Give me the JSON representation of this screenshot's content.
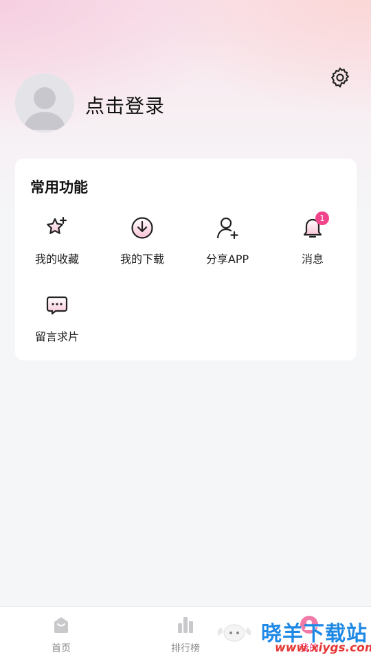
{
  "profile": {
    "login_label": "点击登录"
  },
  "features": {
    "title": "常用功能",
    "items": [
      {
        "label": "我的收藏",
        "icon": "star-plus-icon"
      },
      {
        "label": "我的下载",
        "icon": "download-icon"
      },
      {
        "label": "分享APP",
        "icon": "user-add-icon"
      },
      {
        "label": "消息",
        "icon": "bell-icon",
        "badge": "1"
      },
      {
        "label": "留言求片",
        "icon": "chat-bubble-icon"
      }
    ]
  },
  "tabbar": {
    "items": [
      {
        "label": "首页",
        "icon": "home-icon"
      },
      {
        "label": "排行榜",
        "icon": "ranking-icon"
      },
      {
        "label": "我的",
        "icon": "profile-icon",
        "active": true
      }
    ]
  },
  "watermark": {
    "text": "晓羊下载站",
    "url": "www.xiygs.com"
  },
  "colors": {
    "accent": "#f0458c",
    "card": "#ffffff",
    "background": "#f5f6f8"
  }
}
